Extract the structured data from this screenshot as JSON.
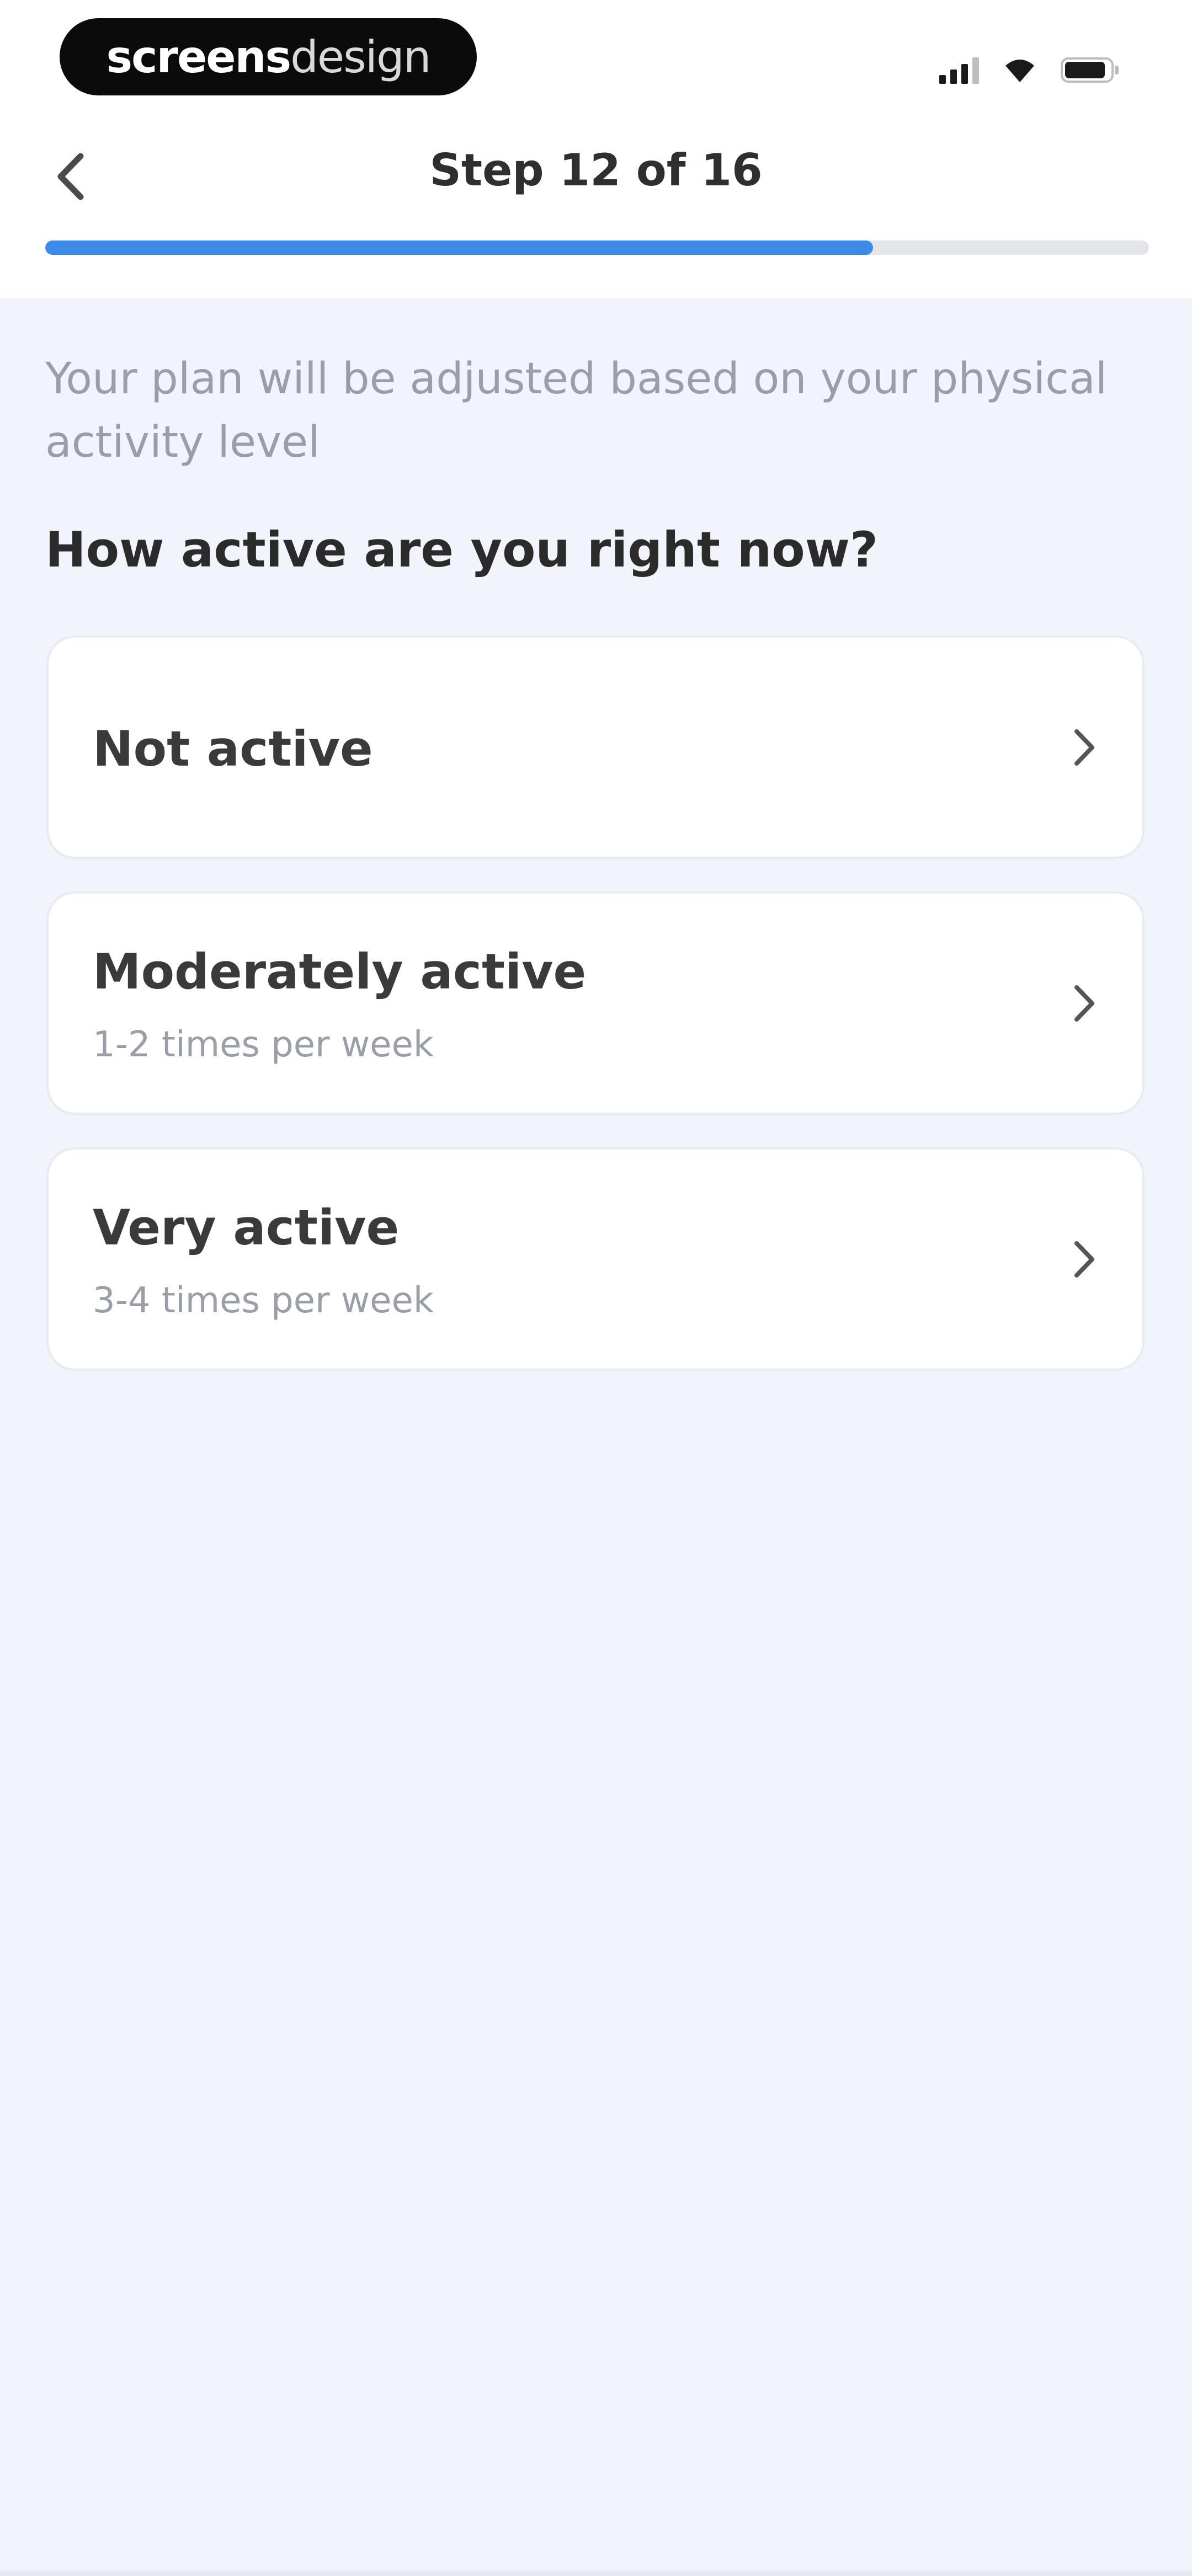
{
  "status_bar": {
    "brand_bold": "screens",
    "brand_light": "design",
    "icons": [
      "cellular-signal-icon",
      "wifi-icon",
      "battery-icon"
    ]
  },
  "header": {
    "back_icon": "chevron-left-icon",
    "step_label": "Step 12 of 16",
    "progress_fraction": 0.75,
    "progress_color": "#3d8be8"
  },
  "main": {
    "intro_text": "Your plan will be adjusted based on your physical activity level",
    "question": "How active are you right now?",
    "options": [
      {
        "title": "Not active",
        "subtitle": ""
      },
      {
        "title": "Moderately active",
        "subtitle": "1-2 times per week"
      },
      {
        "title": "Very active",
        "subtitle": "3-4 times per week"
      }
    ],
    "option_icon": "chevron-right-icon"
  },
  "colors": {
    "background": "#f1f4fb",
    "card": "#ffffff",
    "accent": "#3d8be8"
  }
}
